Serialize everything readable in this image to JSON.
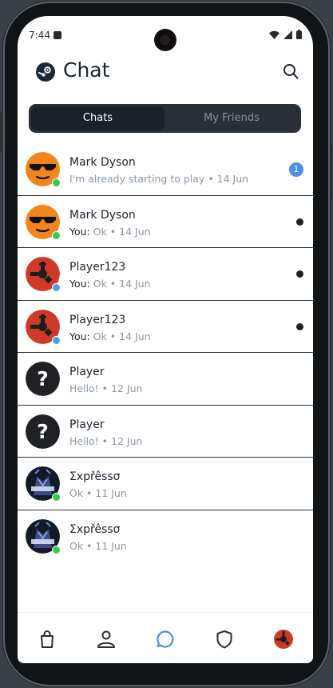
{
  "status": {
    "time": "7:44"
  },
  "header": {
    "title": "Chat",
    "search_icon": "search-icon",
    "logo_icon": "steam-logo-icon"
  },
  "tabs": [
    {
      "label": "Chats",
      "active": true
    },
    {
      "label": "My Friends",
      "active": false
    }
  ],
  "chats": [
    {
      "name": "Mark Dyson",
      "prefix": "",
      "message": "I'm already starting to play",
      "date": "14 Jun",
      "badge": "1",
      "unread_dot": false,
      "avatar": "sunglasses-emoji",
      "presence": "#2ecc52"
    },
    {
      "name": "Mark Dyson",
      "prefix": "You: ",
      "message": "Ok",
      "date": "14 Jun",
      "badge": "",
      "unread_dot": true,
      "avatar": "sunglasses-emoji",
      "presence": "#2ecc52"
    },
    {
      "name": "Player123",
      "prefix": "You: ",
      "message": "Ok",
      "date": "14 Jun",
      "badge": "",
      "unread_dot": true,
      "avatar": "rust-logo",
      "presence": "#4aa3e8"
    },
    {
      "name": "Player123",
      "prefix": "You: ",
      "message": "Ok",
      "date": "14 Jun",
      "badge": "",
      "unread_dot": true,
      "avatar": "rust-logo",
      "presence": "#4aa3e8"
    },
    {
      "name": "Player",
      "prefix": "",
      "message": "Hello!",
      "date": "12 Jun",
      "badge": "",
      "unread_dot": false,
      "avatar": "question-mark",
      "presence": ""
    },
    {
      "name": "Player",
      "prefix": "",
      "message": "Hello!",
      "date": "12 Jun",
      "badge": "",
      "unread_dot": false,
      "avatar": "question-mark",
      "presence": ""
    },
    {
      "name": "Σxpřêssσ",
      "prefix": "",
      "message": "Ok",
      "date": "11 Jun",
      "badge": "",
      "unread_dot": false,
      "avatar": "expresso-art",
      "presence": "#2ecc52"
    },
    {
      "name": "Σxpřêssσ",
      "prefix": "",
      "message": "Ok",
      "date": "11 Jun",
      "badge": "",
      "unread_dot": false,
      "avatar": "expresso-art",
      "presence": "#2ecc52"
    }
  ],
  "colors": {
    "accent": "#4a90e2",
    "online": "#2ecc52",
    "ingame": "#4aa3e8",
    "dark": "#1b212a"
  },
  "nav": [
    {
      "icon": "shopping-bag-icon",
      "active": false
    },
    {
      "icon": "person-icon",
      "active": false
    },
    {
      "icon": "chat-bubble-icon",
      "active": true
    },
    {
      "icon": "shield-icon",
      "active": false
    },
    {
      "icon": "profile-avatar-icon",
      "active": false
    }
  ]
}
